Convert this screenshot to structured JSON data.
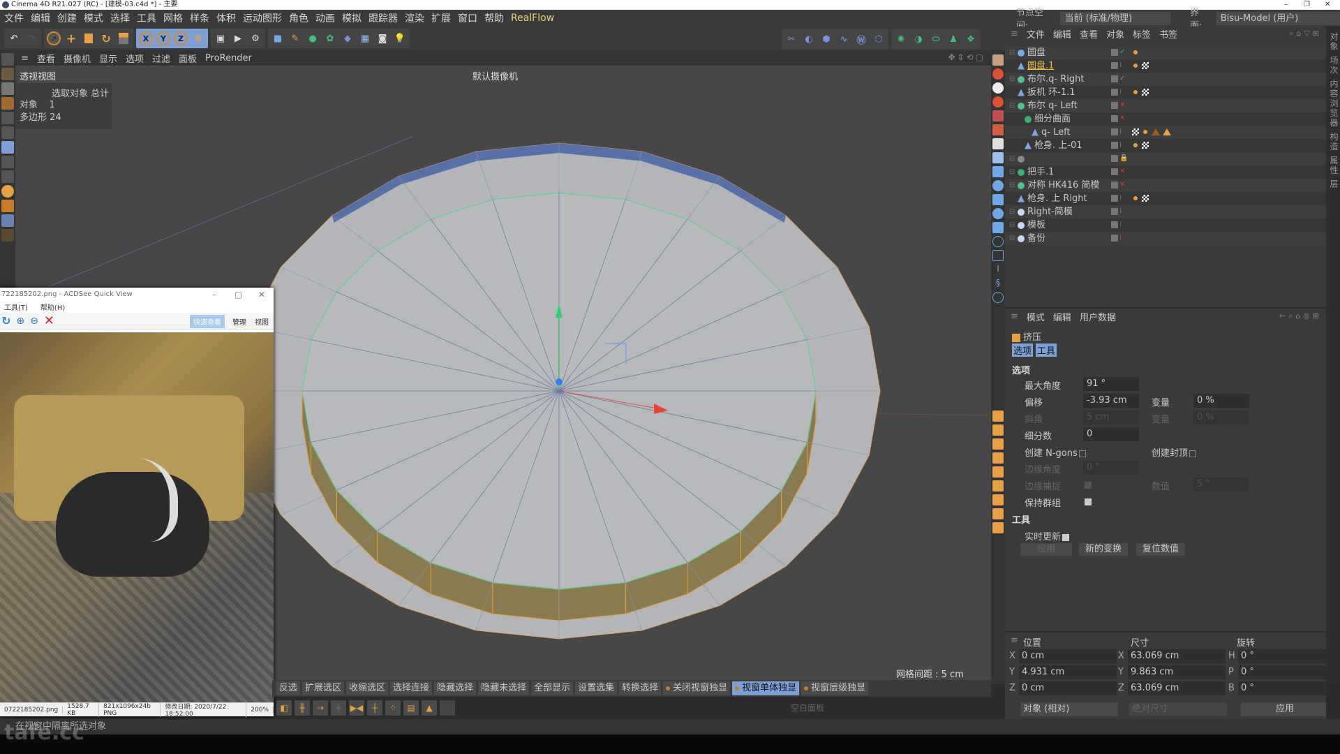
{
  "window": {
    "title": "Cinema 4D R21.027 (RC) - [建模-03.c4d *] - 主要",
    "controls": [
      "–",
      "❐",
      "✕"
    ]
  },
  "menubar": [
    "文件",
    "编辑",
    "创建",
    "模式",
    "选择",
    "工具",
    "网格",
    "样条",
    "体积",
    "运动图形",
    "角色",
    "动画",
    "模拟",
    "跟踪器",
    "渲染",
    "扩展",
    "窗口",
    "帮助",
    "RealFlow"
  ],
  "nodespace": {
    "label": "节点空间:",
    "value": "当前 (标准/物理)",
    "layout_label": "界面:",
    "layout_value": "Bisu-Model (用户)"
  },
  "toolbar": {
    "axes": [
      "X",
      "Y",
      "Z"
    ]
  },
  "viewport": {
    "menu": [
      "查看",
      "摄像机",
      "显示",
      "选项",
      "过滤",
      "面板",
      "ProRender"
    ],
    "label": "透视视图",
    "camera": "默认摄像机",
    "stats": {
      "header": "选取对象 总计",
      "rows": [
        {
          "k": "对象",
          "v": "1"
        },
        {
          "k": "多边形",
          "v": "24"
        }
      ]
    },
    "grid": "网格间距 : 5 cm"
  },
  "acdsee": {
    "title": "722185202.png - ACDSee Quick View",
    "menu": [
      "工具(T)",
      "帮助(H)"
    ],
    "tabs": [
      "快速查看",
      "管理",
      "视图"
    ],
    "status": [
      "0722185202.png",
      "1528.7 KB",
      "821x1096x24b PNG",
      "修改日期: 2020/7/22 18:52:00",
      "200%"
    ]
  },
  "bottombar": {
    "buttons": [
      "反选",
      "扩展选区",
      "收缩选区",
      "选择连接",
      "隐藏选择",
      "隐藏未选择",
      "全部显示",
      "设置选集",
      "转换选择"
    ],
    "solo": [
      "关闭视窗独显",
      "视窗单体独显",
      "视窗层级独显"
    ],
    "solo_active": 1,
    "empty_panel": "空白面板"
  },
  "status": "在视窗中隔离所选对象",
  "watermark": "tafe.cc",
  "objects": {
    "menu": [
      "文件",
      "编辑",
      "查看",
      "对象",
      "标签",
      "书签"
    ],
    "items": [
      {
        "name": "圆盘",
        "indent": 0,
        "icon": "disc",
        "color": "#7aa8e0",
        "selected": false,
        "vis": "check",
        "tags": [
          "points"
        ]
      },
      {
        "name": "圆盘.1",
        "indent": 0,
        "icon": "poly",
        "color": "#7aa8e0",
        "selected": true,
        "vis": "",
        "tags": [
          "points",
          "checker"
        ]
      },
      {
        "name": "布尔.q- Right",
        "indent": 0,
        "icon": "boole",
        "color": "#50c090",
        "selected": false,
        "vis": "check",
        "tags": []
      },
      {
        "name": "扳机 环-1.1",
        "indent": 0,
        "icon": "poly",
        "color": "#7aa8e0",
        "selected": false,
        "vis": "",
        "tags": [
          "points",
          "checker"
        ]
      },
      {
        "name": "布尔 q- Left",
        "indent": 0,
        "icon": "boole",
        "color": "#50c090",
        "selected": false,
        "vis": "x",
        "tags": []
      },
      {
        "name": "细分曲面",
        "indent": 1,
        "icon": "subd",
        "color": "#40b070",
        "selected": false,
        "vis": "x",
        "tags": []
      },
      {
        "name": "q- Left",
        "indent": 2,
        "icon": "poly",
        "color": "#7aa8e0",
        "selected": false,
        "vis": "",
        "tags": [
          "checker",
          "points",
          "tri-outline",
          "tri"
        ]
      },
      {
        "name": "枪身. 上-01",
        "indent": 1,
        "icon": "poly",
        "color": "#7aa8e0",
        "selected": false,
        "vis": "",
        "tags": [
          "points",
          "checker"
        ]
      },
      {
        "name": "",
        "indent": 0,
        "icon": "null",
        "color": "#888",
        "selected": false,
        "vis": "lock",
        "tags": []
      },
      {
        "name": "把手.1",
        "indent": 0,
        "icon": "subd",
        "color": "#40b070",
        "selected": false,
        "vis": "x",
        "tags": []
      },
      {
        "name": "对称 HK416 简模",
        "indent": 0,
        "icon": "sym",
        "color": "#50c090",
        "selected": false,
        "vis": "x",
        "tags": []
      },
      {
        "name": "枪身. 上 Right",
        "indent": 0,
        "icon": "poly",
        "color": "#7aa8e0",
        "selected": false,
        "vis": "",
        "tags": [
          "points",
          "checker"
        ]
      },
      {
        "name": "Right-简模",
        "indent": 0,
        "icon": "null",
        "color": "#c8d8f0",
        "selected": false,
        "vis": "",
        "tags": []
      },
      {
        "name": "模板",
        "indent": 0,
        "icon": "null",
        "color": "#c8d8f0",
        "selected": false,
        "vis": "red",
        "tags": []
      },
      {
        "name": "备份",
        "indent": 0,
        "icon": "null",
        "color": "#c8d8f0",
        "selected": false,
        "vis": "red",
        "tags": []
      }
    ]
  },
  "attributes": {
    "menu": [
      "模式",
      "编辑",
      "用户数据"
    ],
    "tool": "挤压",
    "tabs": [
      "选项",
      "工具"
    ],
    "section_options": "选项",
    "max_angle": {
      "label": "最大角度",
      "value": "91 °"
    },
    "offset": {
      "label": "偏移",
      "value": "-3.93 cm"
    },
    "var1": {
      "label": "变量",
      "value": "0 %"
    },
    "bevel": {
      "label": "斜角",
      "value": "5 cm"
    },
    "var2": {
      "label": "变量",
      "value": "0 %"
    },
    "subdiv": {
      "label": "细分数",
      "value": "0"
    },
    "ngons": {
      "label": "创建 N-gons",
      "checked": false
    },
    "caps": {
      "label": "创建封顶",
      "checked": false
    },
    "edge_angle": {
      "label": "边缘角度",
      "value": "0 °"
    },
    "edge_snap": {
      "label": "边缘捕捉",
      "checked": true
    },
    "snap_value": {
      "label": "数值",
      "value": "5 °"
    },
    "keep_groups": {
      "label": "保持群组",
      "checked": true
    },
    "section_tool": "工具",
    "realtime": {
      "label": "实时更新",
      "checked": true
    },
    "buttons": [
      "应用",
      "新的变换",
      "复位数值"
    ]
  },
  "coords": {
    "headers": [
      "位置",
      "尺寸",
      "旋转"
    ],
    "pos": [
      {
        "axis": "X",
        "value": "0 cm"
      },
      {
        "axis": "Y",
        "value": "4.931 cm"
      },
      {
        "axis": "Z",
        "value": "0 cm"
      }
    ],
    "size": [
      {
        "axis": "X",
        "value": "63.069 cm"
      },
      {
        "axis": "Y",
        "value": "9.863 cm"
      },
      {
        "axis": "Z",
        "value": "63.069 cm"
      }
    ],
    "rot": [
      {
        "axis": "H",
        "value": "0 °"
      },
      {
        "axis": "P",
        "value": "0 °"
      },
      {
        "axis": "B",
        "value": "0 °"
      }
    ],
    "mode": "对象 (相对)",
    "size_mode": "绝对尺寸",
    "apply": "应用"
  },
  "sidetabs": "对象 场次 内容浏览器 构造 属性 层"
}
